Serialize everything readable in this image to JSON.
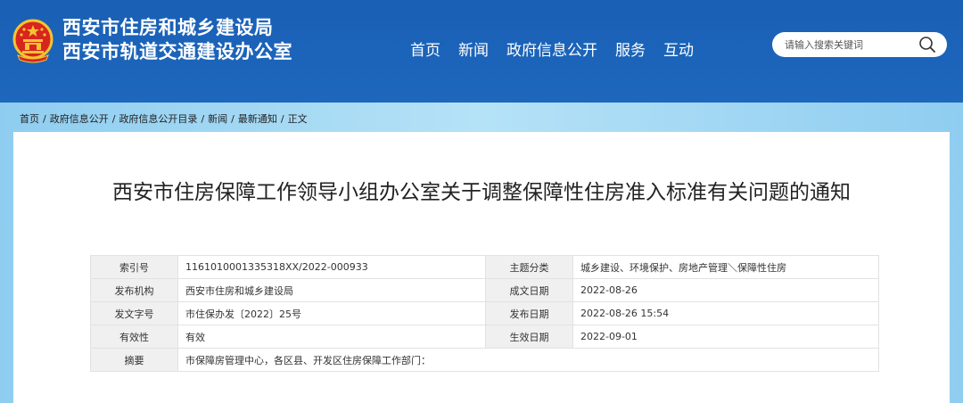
{
  "header": {
    "org_line1": "西安市住房和城乡建设局",
    "org_line2": "西安市轨道交通建设办公室",
    "nav": [
      "首页",
      "新闻",
      "政府信息公开",
      "服务",
      "互动"
    ],
    "search_placeholder": "请输入搜索关键词"
  },
  "breadcrumb": {
    "items": [
      "首页",
      "政府信息公开",
      "政府信息公开目录",
      "新闻",
      "最新通知"
    ],
    "separator": "/",
    "current": "正文"
  },
  "article": {
    "title": "西安市住房保障工作领导小组办公室关于调整保障性住房准入标准有关问题的通知"
  },
  "meta": {
    "rows": [
      {
        "k1": "索引号",
        "v1": "1161010001335318XX/2022-000933",
        "k2": "主题分类",
        "v2": "城乡建设、环境保护、房地产管理＼保障性住房"
      },
      {
        "k1": "发布机构",
        "v1": "西安市住房和城乡建设局",
        "k2": "成文日期",
        "v2": "2022-08-26"
      },
      {
        "k1": "发文字号",
        "v1": "市住保办发〔2022〕25号",
        "k2": "发布日期",
        "v2": "2022-08-26 15:54"
      },
      {
        "k1": "有效性",
        "v1": "有效",
        "k2": "生效日期",
        "v2": "2022-09-01"
      }
    ],
    "abstract_label": "摘要",
    "abstract": "市保障房管理中心，各区县、开发区住房保障工作部门："
  },
  "colors": {
    "header_bg": "#1d67bd",
    "banner_bg": "#9fd3f2",
    "emblem_red": "#d7261e",
    "emblem_gold": "#f4c430"
  }
}
